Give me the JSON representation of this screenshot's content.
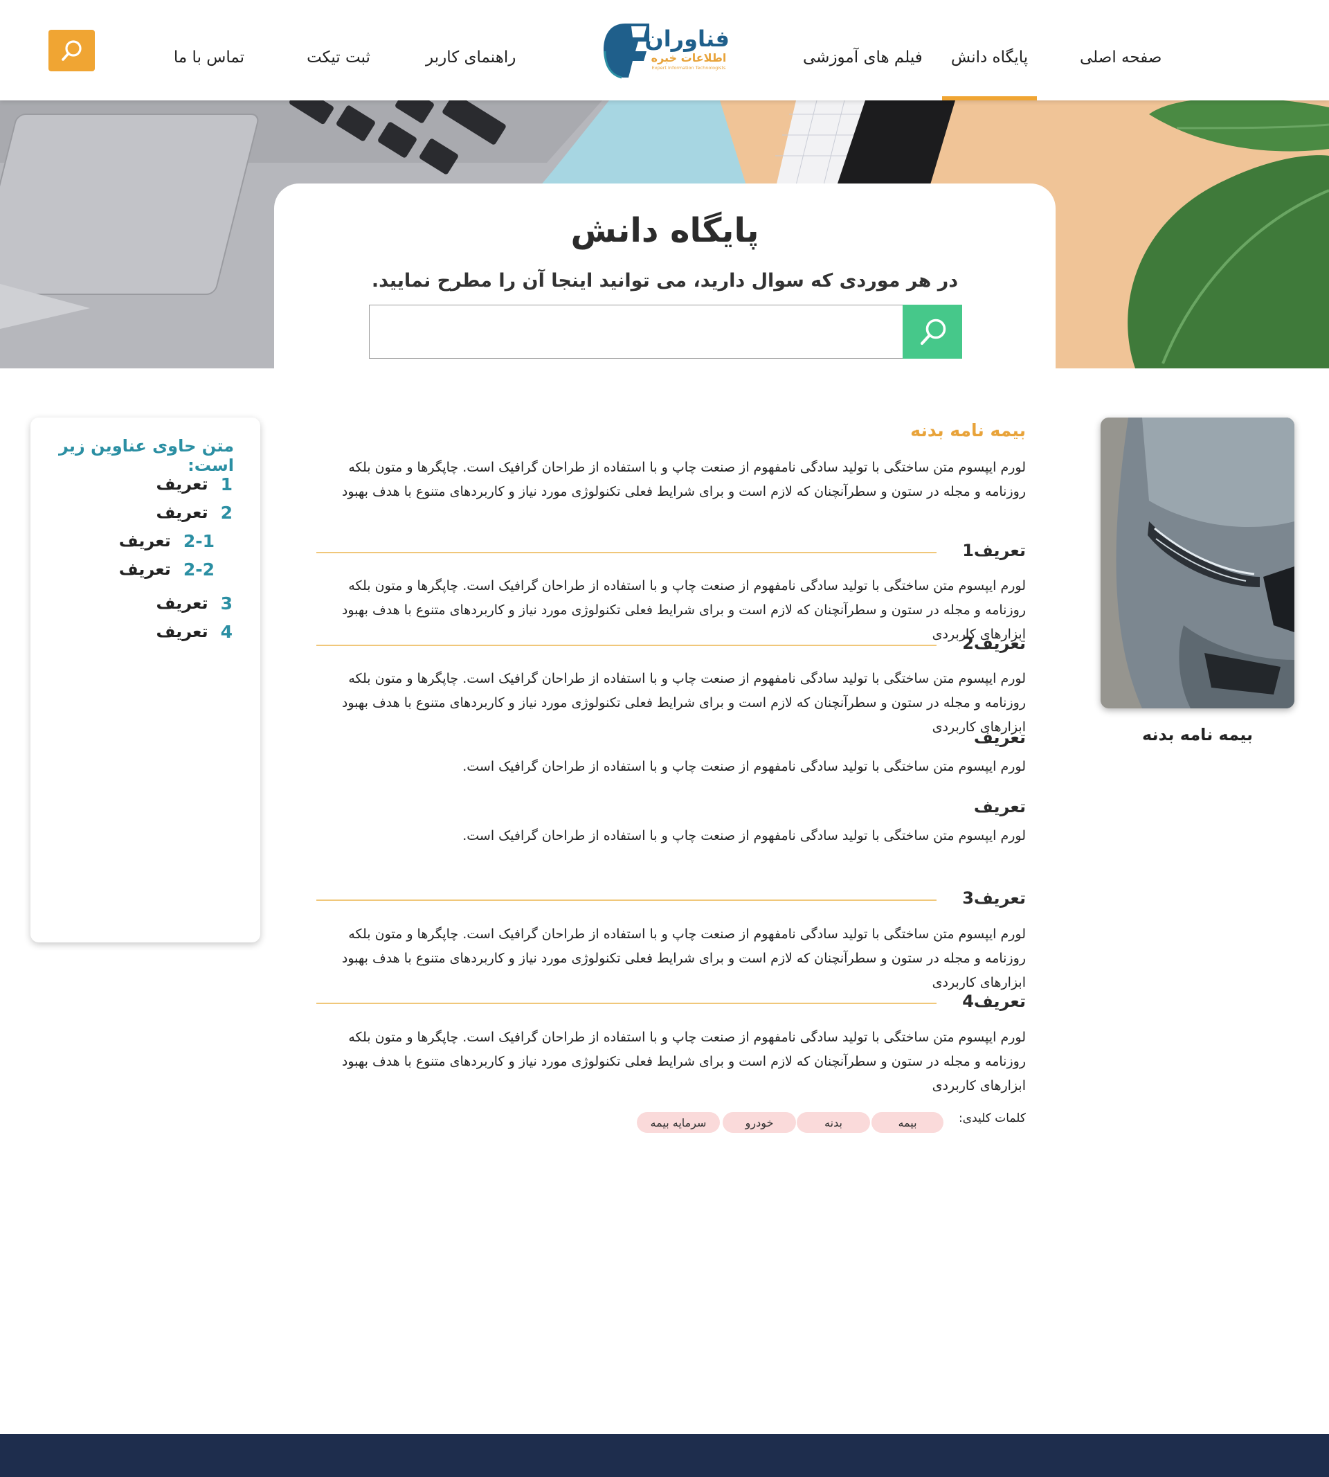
{
  "nav": {
    "items": [
      {
        "label": "صفحه اصلی"
      },
      {
        "label": "پایگاه دانش"
      },
      {
        "label": "فیلم های آموزشی"
      },
      {
        "label": "راهنمای کاربر"
      },
      {
        "label": "ثبت تیکت"
      },
      {
        "label": "تماس با ما"
      }
    ],
    "active_index": 1
  },
  "logo": {
    "name": "فناوران",
    "tagline": "اطلاعات خبره",
    "subtitle": "Expert Information Technologists"
  },
  "hero": {
    "title": "پایگاه دانش",
    "subtitle": "در هر موردی که سوال دارید، می توانید اینجا آن را مطرح نمایید.",
    "search_value": ""
  },
  "toc": {
    "title": "متن حاوی عناوین زیر است:",
    "items": [
      {
        "num": "1",
        "label": "تعریف"
      },
      {
        "num": "2",
        "label": "تعریف"
      },
      {
        "num": "2-1",
        "label": "تعریف"
      },
      {
        "num": "2-2",
        "label": "تعریف"
      },
      {
        "num": "3",
        "label": "تعریف"
      },
      {
        "num": "4",
        "label": "تعریف"
      }
    ]
  },
  "article": {
    "title": "بیمه نامه بدنه",
    "intro": "لورم ایپسوم متن ساختگی با تولید سادگی نامفهوم از صنعت چاپ و با استفاده از طراحان گرافیک است. چاپگرها و متون بلکه روزنامه و مجله در ستون و سطرآنچنان که لازم است و برای شرایط فعلی تکنولوژی مورد نیاز و کاربردهای متنوع با هدف بهبود",
    "sections": [
      {
        "heading": "تعریف1",
        "text": "لورم ایپسوم متن ساختگی با تولید سادگی نامفهوم از صنعت چاپ و با استفاده از طراحان گرافیک است. چاپگرها و متون بلکه روزنامه و مجله در ستون و سطرآنچنان که لازم است و برای شرایط فعلی تکنولوژی مورد نیاز و کاربردهای متنوع با هدف بهبود ابزارهای کاربردی"
      },
      {
        "heading": "تعریف2",
        "text": "لورم ایپسوم متن ساختگی با تولید سادگی نامفهوم از صنعت چاپ و با استفاده از طراحان گرافیک است. چاپگرها و متون بلکه روزنامه و مجله در ستون و سطرآنچنان که لازم است و برای شرایط فعلی تکنولوژی مورد نیاز و کاربردهای متنوع با هدف بهبود ابزارهای کاربردی"
      },
      {
        "heading": "تعریف",
        "text": "لورم ایپسوم متن ساختگی با تولید سادگی نامفهوم از صنعت چاپ و با استفاده از طراحان گرافیک است."
      },
      {
        "heading": "تعریف",
        "text": "لورم ایپسوم متن ساختگی با تولید سادگی نامفهوم از صنعت چاپ و با استفاده از طراحان گرافیک است."
      },
      {
        "heading": "تعریف3",
        "text": "لورم ایپسوم متن ساختگی با تولید سادگی نامفهوم از صنعت چاپ و با استفاده از طراحان گرافیک است. چاپگرها و متون بلکه روزنامه و مجله در ستون و سطرآنچنان که لازم است و برای شرایط فعلی تکنولوژی مورد نیاز و کاربردهای متنوع با هدف بهبود ابزارهای کاربردی"
      },
      {
        "heading": "تعریف4",
        "text": "لورم ایپسوم متن ساختگی با تولید سادگی نامفهوم از صنعت چاپ و با استفاده از طراحان گرافیک است. چاپگرها و متون بلکه روزنامه و مجله در ستون و سطرآنچنان که لازم است و برای شرایط فعلی تکنولوژی مورد نیاز و کاربردهای متنوع با هدف بهبود ابزارهای کاربردی"
      }
    ]
  },
  "card": {
    "caption": "بیمه نامه بدنه"
  },
  "keywords": {
    "label": "کلمات کلیدی:",
    "tags": [
      "بیمه",
      "بدنه",
      "خودرو",
      "سرمایه بیمه"
    ]
  },
  "colors": {
    "accent": "#F0A533",
    "teal": "#2B8FA3",
    "green": "#46C88A",
    "footer": "#1E2D4D",
    "tag_bg": "#FADADA"
  },
  "icons": [
    "search-icon",
    "logo-mark-icon"
  ]
}
